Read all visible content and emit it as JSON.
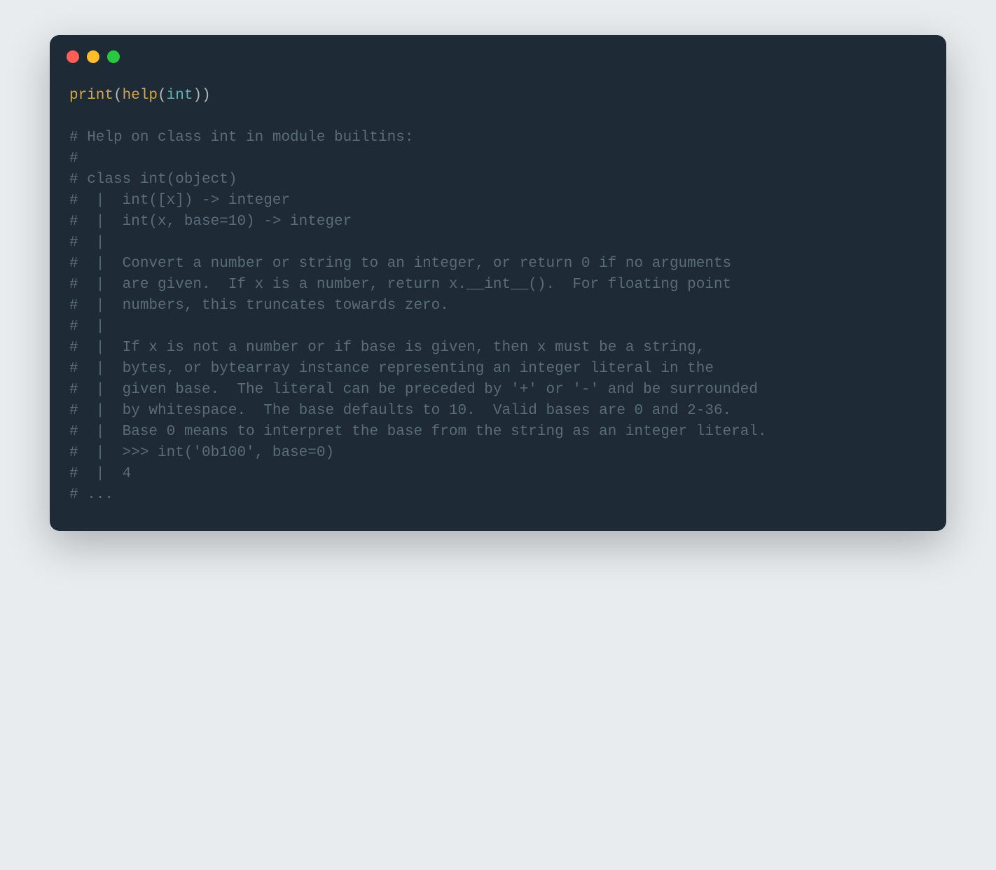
{
  "window": {
    "traffic_lights": [
      "red",
      "yellow",
      "green"
    ]
  },
  "code": {
    "line1": {
      "func1": "print",
      "paren1": "(",
      "func2": "help",
      "paren2": "(",
      "builtin": "int",
      "paren3": ")",
      "paren4": ")"
    },
    "comments": [
      "",
      "# Help on class int in module builtins:",
      "#",
      "# class int(object)",
      "#  |  int([x]) -> integer",
      "#  |  int(x, base=10) -> integer",
      "#  |",
      "#  |  Convert a number or string to an integer, or return 0 if no arguments",
      "#  |  are given.  If x is a number, return x.__int__().  For floating point",
      "#  |  numbers, this truncates towards zero.",
      "#  |",
      "#  |  If x is not a number or if base is given, then x must be a string,",
      "#  |  bytes, or bytearray instance representing an integer literal in the",
      "#  |  given base.  The literal can be preceded by '+' or '-' and be surrounded",
      "#  |  by whitespace.  The base defaults to 10.  Valid bases are 0 and 2-36.",
      "#  |  Base 0 means to interpret the base from the string as an integer literal.",
      "#  |  >>> int('0b100', base=0)",
      "#  |  4",
      "# ..."
    ]
  }
}
